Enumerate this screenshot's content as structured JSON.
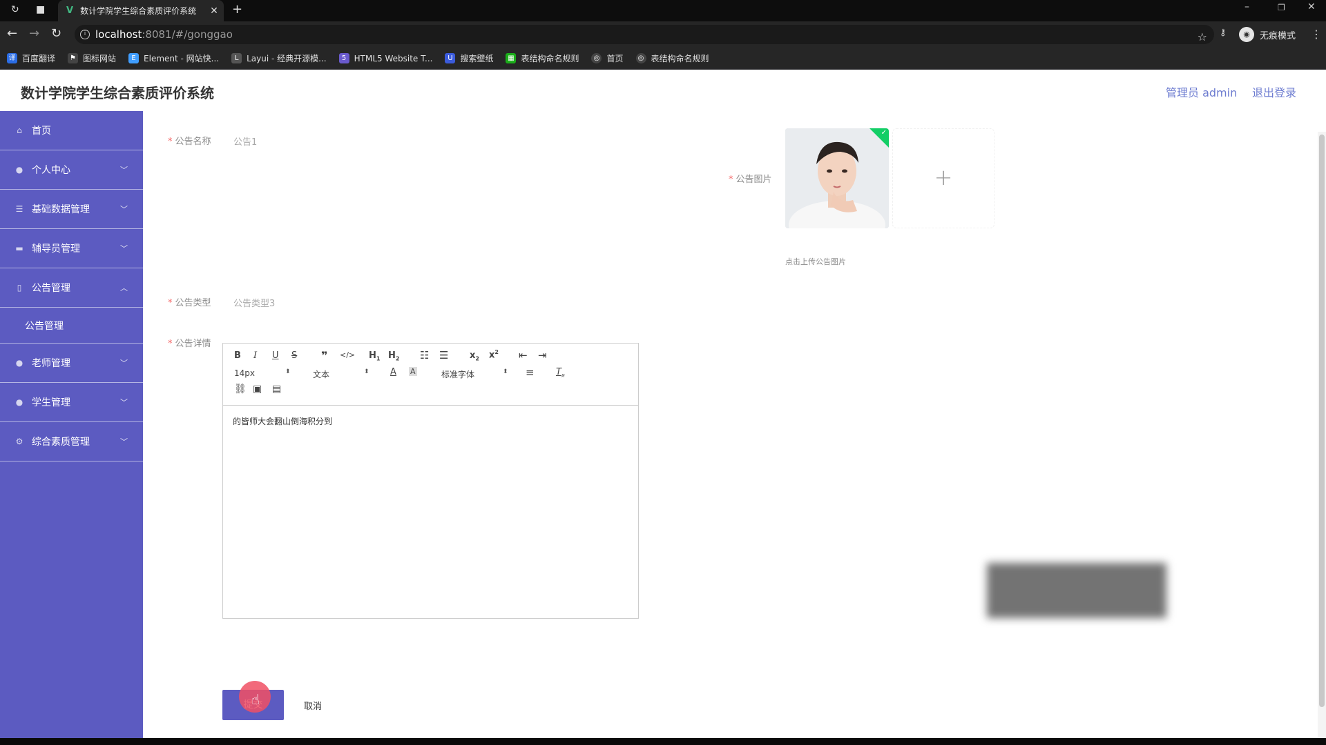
{
  "browser": {
    "tab_title": "数计学院学生综合素质评价系统",
    "url_host": "localhost",
    "url_path": ":8081/#/gonggao",
    "incognito_label": "无痕模式",
    "bookmarks": [
      {
        "label": "百度翻译",
        "icon": "translate-icon",
        "color": "#2b6de5"
      },
      {
        "label": "图标网站",
        "icon": "flag-icon",
        "color": "#444444"
      },
      {
        "label": "Element - 网站快...",
        "icon": "element-icon",
        "color": "#409eff"
      },
      {
        "label": "Layui - 经典开源模...",
        "icon": "layui-icon",
        "color": "#555555"
      },
      {
        "label": "HTML5 Website T...",
        "icon": "html5-icon",
        "color": "#6a5acd"
      },
      {
        "label": "搜索壁纸",
        "icon": "wallpaper-icon",
        "color": "#3b5bdb"
      },
      {
        "label": "表结构命名规则",
        "icon": "sheet-icon",
        "color": "#1aad19"
      },
      {
        "label": "首页",
        "icon": "globe-icon",
        "color": "#444444"
      },
      {
        "label": "表结构命名规则",
        "icon": "globe-icon",
        "color": "#444444"
      }
    ]
  },
  "header": {
    "title": "数计学院学生综合素质评价系统",
    "admin_label": "管理员 admin",
    "logout_label": "退出登录"
  },
  "sidebar": {
    "items": [
      {
        "label": "首页",
        "icon": "home-icon",
        "expandable": false
      },
      {
        "label": "个人中心",
        "icon": "user-icon",
        "expandable": true
      },
      {
        "label": "基础数据管理",
        "icon": "list-icon",
        "expandable": true
      },
      {
        "label": "辅导员管理",
        "icon": "chat-icon",
        "expandable": true
      },
      {
        "label": "公告管理",
        "icon": "mic-icon",
        "expandable": true,
        "expanded": true,
        "children": [
          "公告管理"
        ]
      },
      {
        "label": "老师管理",
        "icon": "pin-icon",
        "expandable": true
      },
      {
        "label": "学生管理",
        "icon": "user-icon",
        "expandable": true
      },
      {
        "label": "综合素质管理",
        "icon": "gear-icon",
        "expandable": true
      }
    ]
  },
  "form": {
    "name_label": "公告名称",
    "name_value": "公告1",
    "image_label": "公告图片",
    "image_tip": "点击上传公告图片",
    "type_label": "公告类型",
    "type_value": "公告类型3",
    "detail_label": "公告详情",
    "editor": {
      "font_size": "14px",
      "header_select": "文本",
      "font_family": "标准字体",
      "content": "的皆师大会翻山倒海积分到"
    },
    "submit_label": "提交",
    "cancel_label": "取消"
  },
  "colors": {
    "primary": "#5c5bc1",
    "header_link": "#6c7bd0",
    "required": "#f56c6c",
    "success": "#13ce66"
  }
}
